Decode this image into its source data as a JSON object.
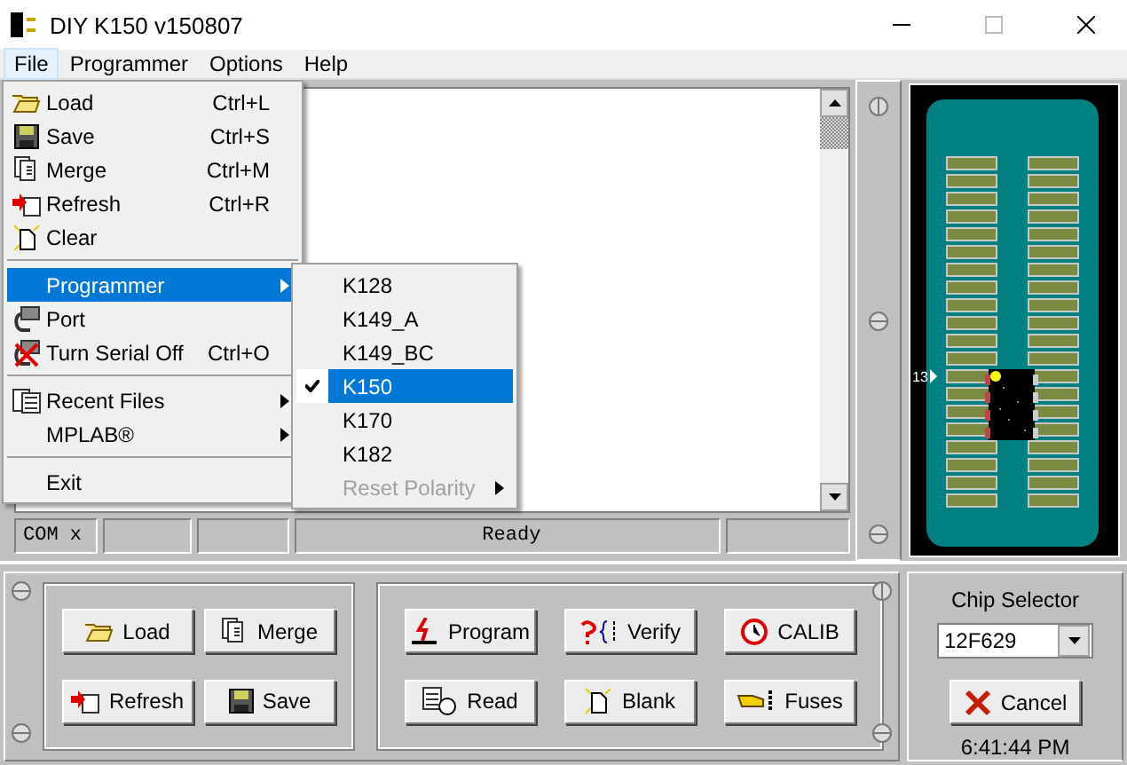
{
  "window": {
    "title": "DIY K150 v150807"
  },
  "menubar": [
    {
      "label": "File",
      "selected": true
    },
    {
      "label": "Programmer",
      "selected": false
    },
    {
      "label": "Options",
      "selected": false
    },
    {
      "label": "Help",
      "selected": false
    }
  ],
  "file_menu": [
    {
      "kind": "item",
      "label": "Load",
      "shortcut": "Ctrl+L",
      "selected": false
    },
    {
      "kind": "item",
      "label": "Save",
      "shortcut": "Ctrl+S",
      "selected": false
    },
    {
      "kind": "item",
      "label": "Merge",
      "shortcut": "Ctrl+M",
      "selected": false
    },
    {
      "kind": "item",
      "label": "Refresh",
      "shortcut": "Ctrl+R",
      "selected": false
    },
    {
      "kind": "item",
      "label": "Clear",
      "selected": false
    },
    {
      "kind": "separator"
    },
    {
      "kind": "submenu",
      "label": "Programmer",
      "selected": true
    },
    {
      "kind": "item",
      "label": "Port",
      "selected": false
    },
    {
      "kind": "item",
      "label": "Turn Serial Off",
      "shortcut": "Ctrl+O",
      "selected": false
    },
    {
      "kind": "separator"
    },
    {
      "kind": "submenu",
      "label": "Recent Files",
      "selected": false
    },
    {
      "kind": "submenu",
      "label": "MPLAB®",
      "selected": false
    },
    {
      "kind": "separator"
    },
    {
      "kind": "item",
      "label": "Exit",
      "selected": false
    }
  ],
  "programmer_menu": [
    {
      "label": "K128",
      "checked": false,
      "selected": false,
      "disabled": false,
      "submenu": false
    },
    {
      "label": "K149_A",
      "checked": false,
      "selected": false,
      "disabled": false,
      "submenu": false
    },
    {
      "label": "K149_BC",
      "checked": false,
      "selected": false,
      "disabled": false,
      "submenu": false
    },
    {
      "label": "K150",
      "checked": true,
      "selected": true,
      "disabled": false,
      "submenu": false
    },
    {
      "label": "K170",
      "checked": false,
      "selected": false,
      "disabled": false,
      "submenu": false
    },
    {
      "label": "K182",
      "checked": false,
      "selected": false,
      "disabled": false,
      "submenu": false
    },
    {
      "label": "Reset Polarity",
      "checked": false,
      "selected": false,
      "disabled": true,
      "submenu": true
    }
  ],
  "status_bar": {
    "port": "COM x",
    "message": "Ready"
  },
  "socket": {
    "pin_label": "13"
  },
  "file_buttons": [
    {
      "label": "Load"
    },
    {
      "label": "Merge"
    },
    {
      "label": "Refresh"
    },
    {
      "label": "Save"
    }
  ],
  "chip_buttons": [
    {
      "label": "Program"
    },
    {
      "label": "Verify"
    },
    {
      "label": "CALIB"
    },
    {
      "label": "Read"
    },
    {
      "label": "Blank"
    },
    {
      "label": "Fuses"
    }
  ],
  "chip_selector": {
    "label": "Chip Selector",
    "value": "12F629",
    "cancel": "Cancel",
    "clock": "6:41:44 PM"
  }
}
